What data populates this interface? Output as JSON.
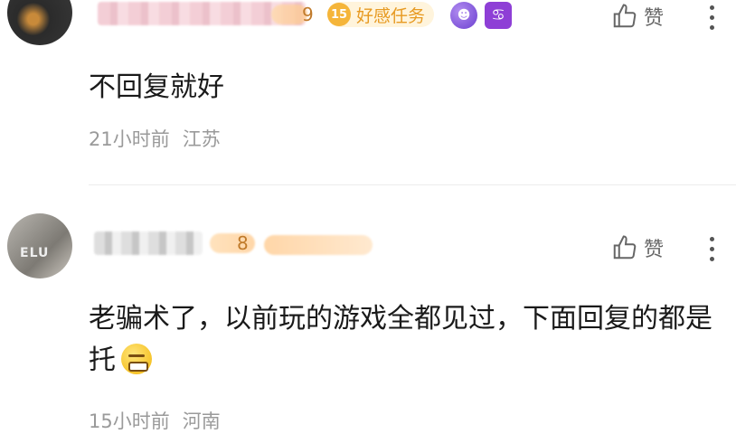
{
  "comments": [
    {
      "level_badge": {
        "number": "15",
        "label": "好感任务"
      },
      "name_suffix": "9",
      "zodiac_icon": "cancer-icon",
      "zodiac_glyph": "♋",
      "like_label": "赞",
      "text": "不回复就好",
      "time": "21小时前",
      "location": "江苏"
    },
    {
      "avatar_text": "ELU",
      "name_suffix": "8",
      "like_label": "赞",
      "text": "老骗术了，以前玩的游戏全都见过，下面回复的都是托",
      "emoji": "grimace-emoji-icon",
      "time": "15小时前",
      "location": "河南"
    }
  ],
  "colors": {
    "accent_level": "#f5b53a",
    "zodiac": "#8e3fd6",
    "meta": "#9a9a9a"
  }
}
